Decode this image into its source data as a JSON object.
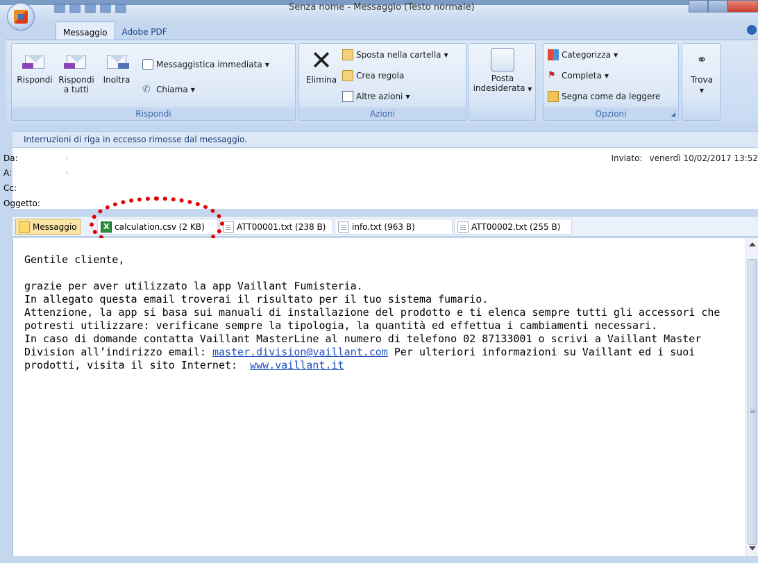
{
  "window": {
    "title": "Senza nome - Messaggio (Testo normale)"
  },
  "tabs": [
    {
      "label": "Messaggio",
      "active": true
    },
    {
      "label": "Adobe PDF",
      "active": false
    }
  ],
  "ribbon": {
    "rispondi": {
      "label": "Rispondi",
      "reply": "Rispondi",
      "reply_all_line1": "Rispondi",
      "reply_all_line2": "a tutti",
      "forward": "Inoltra",
      "instant_messaging": "Messaggistica immediata",
      "call": "Chiama"
    },
    "azioni": {
      "label": "Azioni",
      "delete": "Elimina",
      "move_to_folder": "Sposta nella cartella",
      "create_rule": "Crea regola",
      "other_actions": "Altre azioni"
    },
    "junk": {
      "line1": "Posta",
      "line2": "indesiderata"
    },
    "opzioni": {
      "label": "Opzioni",
      "categorize": "Categorizza",
      "follow_up": "Completa",
      "mark_unread": "Segna come da leggere"
    },
    "find": {
      "label": "Trova"
    }
  },
  "infobar": {
    "text": "Interruzioni di riga in eccesso rimosse dal messaggio."
  },
  "header": {
    "from_label": "Da:",
    "to_label": "A:",
    "cc_label": "Cc:",
    "subject_label": "Oggetto:",
    "from_value": "‹",
    "to_value": "‹",
    "sent_label": "Inviato:",
    "sent_value": "venerdì 10/02/2017 13:52"
  },
  "attachments": [
    {
      "label": "Messaggio",
      "icon": "envelope-icon",
      "selected": true
    },
    {
      "label": "calculation.csv (2 KB)",
      "icon": "excel-file-icon",
      "selected": false
    },
    {
      "label": "ATT00001.txt (238 B)",
      "icon": "text-file-icon",
      "selected": false
    },
    {
      "label": "info.txt (963 B)",
      "icon": "text-file-icon",
      "selected": false
    },
    {
      "label": "ATT00002.txt (255 B)",
      "icon": "text-file-icon",
      "selected": false
    }
  ],
  "body": {
    "greeting": "Gentile cliente,",
    "p1": "grazie per aver utilizzato la app Vaillant Fumisteria.",
    "p2": "In allegato questa email troverai il risultato per il tuo sistema fumario.",
    "p3": "Attenzione, la app si basa sui manuali di installazione del prodotto e ti elenca sempre tutti gli accessori che potresti utilizzare: verificane sempre la tipologia, la quantità ed effettua i cambiamenti necessari.",
    "p4_pre": "In caso di domande contatta Vaillant MasterLine al numero di telefono 02 87133001 o scrivi a Vaillant Master Division all’indirizzo email: ",
    "email_link": "master.division@vaillant.com",
    "p4_mid": " Per ulteriori informazioni su Vaillant ed i suoi prodotti, visita il sito Internet:  ",
    "web_link": "www.vaillant.it"
  },
  "colors": {
    "annotation": "#e00000",
    "link": "#1f4fbf",
    "ribbon_label": "#3e6aaa"
  }
}
